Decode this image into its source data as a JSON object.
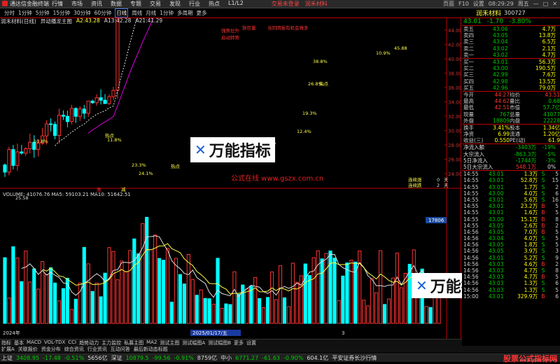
{
  "app": {
    "title": "通达信金融终端",
    "menus": [
      "行情",
      "市场",
      "资讯",
      "数据",
      "专题",
      "交易",
      "发现",
      "行业",
      "热点",
      "L1/L2"
    ],
    "notices": [
      "交易未登录",
      "润禾材料"
    ],
    "time": "08:29:29",
    "weekday": "周五",
    "rightbtns": [
      "页面",
      "F10",
      "设置"
    ]
  },
  "toolbar": {
    "periods": [
      "分时",
      "1分钟",
      "5分钟",
      "15分钟",
      "30分钟",
      "60分钟",
      "日线",
      "周线",
      "月线",
      "1分钟",
      "多周期",
      "更多"
    ],
    "selected": "日线"
  },
  "stock": {
    "header": "润禾材料(日线)",
    "indicator": "异动播龙主图",
    "ma_labels": [
      {
        "t": "A2:43.28",
        "c": "#ff4"
      },
      {
        "t": "A13:42.28",
        "c": "#ddd"
      },
      {
        "t": "A21:41.29",
        "c": "#ddd"
      }
    ]
  },
  "chart": {
    "annotations": [
      {
        "t": "强势拉升",
        "c": "#f33"
      },
      {
        "t": "启动转势",
        "c": "#f33"
      },
      {
        "t": "放巨量",
        "c": "#f33"
      },
      {
        "t": "当同阴板有机会做多",
        "c": "#f33"
      },
      {
        "t": "热点",
        "c": "#ff4"
      },
      {
        "t": "热点",
        "c": "#ff4"
      },
      {
        "t": "热点",
        "c": "#ff4"
      },
      {
        "t": "公式在线  www.gszx.com.cn",
        "c": "#d22"
      },
      {
        "t": "连续涨",
        "c": "#ff4"
      },
      {
        "t": "连续跌",
        "c": "#ff4"
      },
      {
        "t": "0",
        "c": "#ddd"
      },
      {
        "t": "2",
        "c": "#ddd"
      },
      {
        "t": "天",
        "c": "#ddd"
      },
      {
        "t": "天",
        "c": "#ddd"
      },
      {
        "t": "涨",
        "c": "#f33"
      },
      {
        "t": "减",
        "c": "#ff4"
      }
    ],
    "pct_labels": [
      "10.8%",
      "10.9%",
      "26.8%",
      "38.8%",
      "19.3%",
      "12.4%",
      "8.1%",
      "11.8%",
      "24.1%",
      "23.3%",
      "25.58",
      "45.88"
    ],
    "price_axis": [
      "44.00",
      "42.00",
      "40.00",
      "38.00",
      "36.00",
      "34.00",
      "32.00",
      "30.00",
      "28.00",
      "26.00",
      "24.00"
    ],
    "volume": {
      "label": "VOLUME: 41076.76  MA5: 59103.21  MA10: 51642.51",
      "axis": [
        "17806"
      ]
    },
    "date_labels": [
      "2024年",
      "2025/01/17/五",
      "3"
    ]
  },
  "logo": {
    "text": "万能指标"
  },
  "panel": {
    "name": "润禾材料",
    "code": "300727",
    "price": "43.01",
    "chg": "-1.70",
    "pct": "-3.80%",
    "asks": [
      {
        "l": "卖五",
        "p": "43.06",
        "v": "4.7万"
      },
      {
        "l": "卖四",
        "p": "43.05",
        "v": "13.8万"
      },
      {
        "l": "卖三",
        "p": "43.04",
        "v": "6.5万"
      },
      {
        "l": "卖二",
        "p": "43.02",
        "v": "2.1万"
      },
      {
        "l": "卖一",
        "p": "43.02",
        "v": "4.7万"
      }
    ],
    "bids": [
      {
        "l": "买一",
        "p": "43.01",
        "v": "56.3万"
      },
      {
        "l": "买二",
        "p": "43.00",
        "v": "190.5万"
      },
      {
        "l": "买三",
        "p": "42.99",
        "v": "7.6万"
      },
      {
        "l": "买四",
        "p": "42.98",
        "v": "13.5万"
      },
      {
        "l": "买五",
        "p": "42.96",
        "v": "79.0万"
      }
    ],
    "stats": [
      [
        "今开",
        "44.27",
        "均价",
        "43.51"
      ],
      [
        "最高",
        "44.62",
        "量比",
        "0.68"
      ],
      [
        "最低",
        "42.51",
        "市值",
        "57.7亿"
      ],
      [
        "现量",
        "767",
        "总量",
        "41077"
      ],
      [
        "外盘",
        "18809",
        "内盘",
        "22228"
      ]
    ],
    "stats2": [
      [
        "换手",
        "3.41%",
        "股本",
        "1.34亿"
      ],
      [
        "净资",
        "6.99",
        "流通",
        "1.20亿"
      ],
      [
        "收益(三)",
        "0.550",
        "PE(动)",
        "61.9"
      ]
    ],
    "flows": [
      [
        "净流入额",
        "-3403万",
        "-19%"
      ],
      [
        "大宗流入",
        "-863.3万",
        "-5%"
      ],
      [
        "5日净流入",
        "-1744万",
        "-3%"
      ],
      [
        "5日大宗流入",
        "548.1万",
        "0%"
      ]
    ],
    "ticks": [
      [
        "14:55",
        "43.01",
        "1.3万",
        "S",
        "5"
      ],
      [
        "14:55",
        "43.01",
        "52.8万",
        "S",
        "15"
      ],
      [
        "14:55",
        "43.01",
        "1.7万",
        "S",
        "2"
      ],
      [
        "14:55",
        "43.00",
        "4.0万",
        "S",
        "6"
      ],
      [
        "14:55",
        "43.01",
        "5.6万",
        "S",
        "16"
      ],
      [
        "14:55",
        "43.01",
        "23.2万",
        "B",
        "5"
      ],
      [
        "14:55",
        "43.01",
        "1.6万",
        "B",
        "5"
      ],
      [
        "14:55",
        "43.00",
        "15.1万",
        "B",
        "8"
      ],
      [
        "14:55",
        "43.05",
        "2.6万",
        "B",
        "2"
      ],
      [
        "14:56",
        "43.05",
        "7.0万",
        "B",
        "5"
      ],
      [
        "14:56",
        "43.04",
        "4.0万",
        "S",
        "5"
      ],
      [
        "14:56",
        "43.05",
        "1.8万",
        "S",
        "5"
      ],
      [
        "14:56",
        "43.05",
        "3.9万",
        "S",
        "3"
      ],
      [
        "14:56",
        "43.01",
        "5.2万",
        "S",
        "9"
      ],
      [
        "14:56",
        "43.03",
        "4.6万",
        "B",
        "2"
      ],
      [
        "14:56",
        "43.03",
        "4.7万",
        "S",
        "8"
      ],
      [
        "14:56",
        "43.03",
        "4.7万",
        "B",
        "5"
      ],
      [
        "14:56",
        "43.03",
        "1.3万",
        "S",
        "6"
      ],
      [
        "14:56",
        "43.03",
        "1.3万",
        "S",
        "5"
      ],
      [
        "15:00",
        "43.01",
        "329.9万",
        "B",
        "6"
      ]
    ]
  },
  "bottomtabs": [
    "指标",
    "基本",
    "MACD",
    "VOL-TDX",
    "CCI",
    "趋势动力",
    "主力监控",
    "私募主图",
    "MA2",
    "测试主图",
    "测试幅图A",
    "测试幅图B",
    "更多",
    "设置"
  ],
  "bottomtabs2": [
    "扩展A",
    "关联报价",
    "资金分布",
    "综合资讯",
    "行业资讯",
    "互动问答",
    "最后新动态标题"
  ],
  "status": {
    "items": [
      {
        "t": "上证",
        "c": "#ddd"
      },
      {
        "t": "3408.95",
        "c": "#0c0"
      },
      {
        "t": "-17.48",
        "c": "#0c0"
      },
      {
        "t": "-0.51%",
        "c": "#0c0"
      },
      {
        "t": "5656亿",
        "c": "#ddd"
      },
      {
        "t": "深证",
        "c": "#ddd"
      },
      {
        "t": "10879.5",
        "c": "#0c0"
      },
      {
        "t": "-99.56",
        "c": "#0c0"
      },
      {
        "t": "-0.91%",
        "c": "#0c0"
      },
      {
        "t": "8759亿",
        "c": "#ddd"
      },
      {
        "t": "中小",
        "c": "#ddd"
      },
      {
        "t": "6771.27",
        "c": "#0c0"
      },
      {
        "t": "-61.63",
        "c": "#0c0"
      },
      {
        "t": "-0.90%",
        "c": "#0c0"
      },
      {
        "t": "604.1亿",
        "c": "#ddd"
      },
      {
        "t": "平安证券长沙行情",
        "c": "#ddd"
      }
    ],
    "watermark": "股票公式指标网",
    "watermark_url": "www.gszx.com.cn"
  }
}
